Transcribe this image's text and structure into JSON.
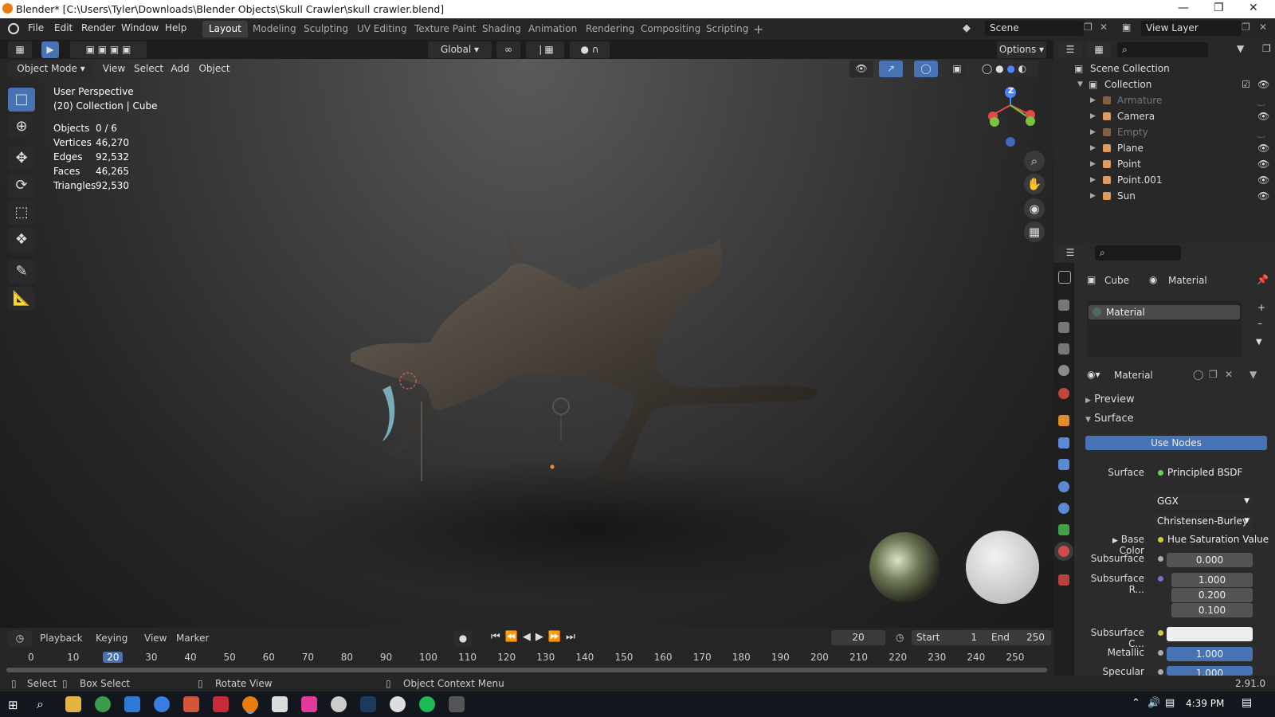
{
  "window": {
    "title": "Blender* [C:\\Users\\Tyler\\Downloads\\Blender Objects\\Skull Crawler\\skull crawler.blend]"
  },
  "menu": [
    "File",
    "Edit",
    "Render",
    "Window",
    "Help"
  ],
  "workspaces": [
    "Layout",
    "Modeling",
    "Sculpting",
    "UV Editing",
    "Texture Paint",
    "Shading",
    "Animation",
    "Rendering",
    "Compositing",
    "Scripting"
  ],
  "scene": {
    "label": "Scene",
    "view_layer": "View Layer"
  },
  "header": {
    "transform_orientation": "Global",
    "options": "Options",
    "mode": "Object Mode",
    "view_menu": [
      "View",
      "Select",
      "Add",
      "Object"
    ]
  },
  "viewport": {
    "perspective": "User Perspective",
    "collection": "(20) Collection | Cube",
    "stats": [
      {
        "label": "Objects",
        "value": "0 / 6"
      },
      {
        "label": "Vertices",
        "value": "46,270"
      },
      {
        "label": "Edges",
        "value": "92,532"
      },
      {
        "label": "Faces",
        "value": "46,265"
      },
      {
        "label": "Triangles",
        "value": "92,530"
      }
    ],
    "gizmo_z": "Z"
  },
  "timeline": {
    "menus": [
      "Playback",
      "Keying",
      "View",
      "Marker"
    ],
    "current_frame": "20",
    "start_label": "Start",
    "start": "1",
    "end_label": "End",
    "end": "250",
    "ticks": [
      "0",
      "10",
      "20",
      "30",
      "40",
      "50",
      "60",
      "70",
      "80",
      "90",
      "100",
      "110",
      "120",
      "130",
      "140",
      "150",
      "160",
      "170",
      "180",
      "190",
      "200",
      "210",
      "220",
      "230",
      "240",
      "250"
    ]
  },
  "status": {
    "select": "Select",
    "box_select": "Box Select",
    "rotate_view": "Rotate View",
    "context_menu": "Object Context Menu",
    "version": "2.91.0"
  },
  "outliner": {
    "scene_collection": "Scene Collection",
    "collection": "Collection",
    "items": [
      {
        "name": "Armature",
        "visible": false
      },
      {
        "name": "Camera",
        "visible": true
      },
      {
        "name": "Empty",
        "visible": false
      },
      {
        "name": "Plane",
        "visible": true
      },
      {
        "name": "Point",
        "visible": true
      },
      {
        "name": "Point.001",
        "visible": true
      },
      {
        "name": "Sun",
        "visible": true
      }
    ]
  },
  "properties": {
    "breadcrumb_object": "Cube",
    "breadcrumb_material": "Material",
    "slot": "Material",
    "material_name": "Material",
    "preview": "Preview",
    "surface_panel": "Surface",
    "use_nodes": "Use Nodes",
    "surface_label": "Surface",
    "surface_value": "Principled BSDF",
    "distribution": "GGX",
    "subsurface_method": "Christensen-Burley",
    "base_color_label": "Base Color",
    "base_color_value": "Hue Saturation Value",
    "subsurface_label": "Subsurface",
    "subsurface_value": "0.000",
    "subsurface_radius_label": "Subsurface R...",
    "subsurface_radius": [
      "1.000",
      "0.200",
      "0.100"
    ],
    "subsurface_color_label": "Subsurface C...",
    "metallic_label": "Metallic",
    "metallic_value": "1.000",
    "specular_label": "Specular",
    "specular_value": "1.000"
  },
  "taskbar": {
    "time": "4:39 PM"
  },
  "colors": {
    "accent": "#4772b3",
    "active_tab": "#3d3d3d",
    "panel": "#2b2b2b"
  }
}
